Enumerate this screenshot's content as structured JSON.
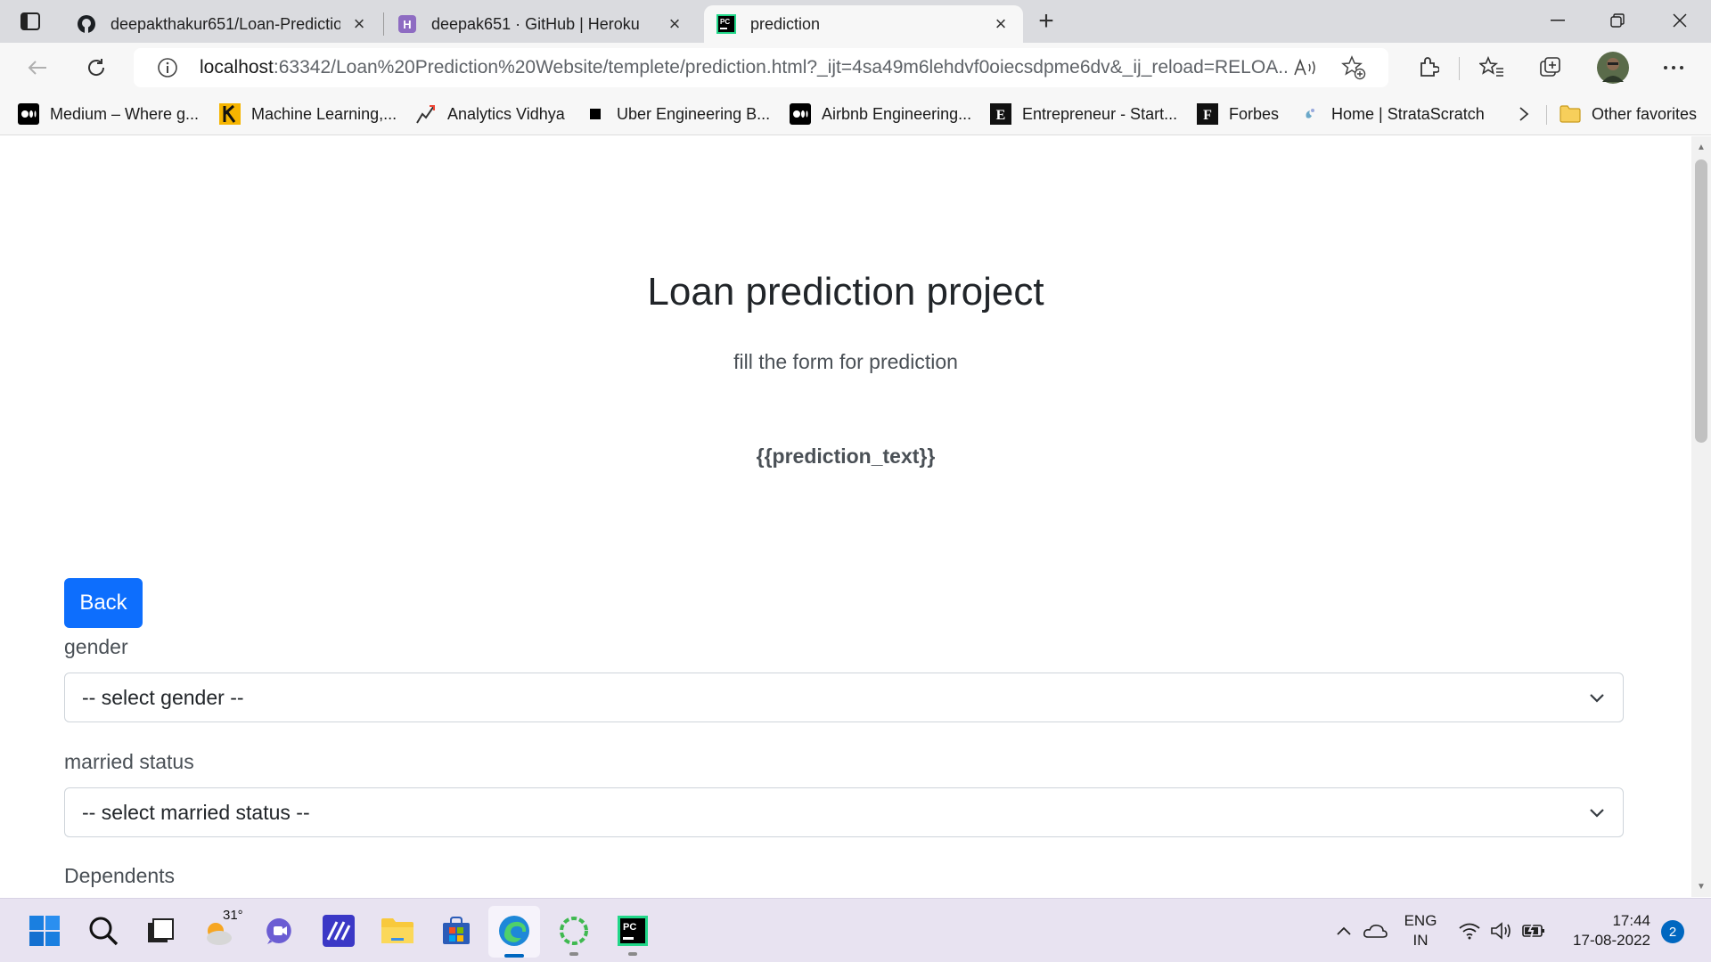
{
  "browser": {
    "tabs": [
      {
        "title": "deepakthakur651/Loan-Predictio",
        "icon": "github-icon"
      },
      {
        "title": "deepak651 · GitHub | Heroku",
        "icon": "heroku-icon"
      },
      {
        "title": "prediction",
        "icon": "pycharm-icon"
      }
    ],
    "active_tab": 2,
    "url_host": "localhost",
    "url_rest": ":63342/Loan%20Prediction%20Website/templete/prediction.html?_ijt=4sa49m6lehdvf0oiecsdpme6dv&_ij_reload=RELOA...",
    "read_aloud": "A’’",
    "favorites": [
      {
        "label": "Medium – Where g...",
        "icon": "medium-icon"
      },
      {
        "label": "Machine Learning,...",
        "icon": "kdnuggets-icon"
      },
      {
        "label": "Analytics Vidhya",
        "icon": "analytics-vidhya-icon"
      },
      {
        "label": "Uber Engineering B...",
        "icon": "uber-icon"
      },
      {
        "label": "Airbnb Engineering...",
        "icon": "medium-icon"
      },
      {
        "label": "Entrepreneur - Start...",
        "icon": "entrepreneur-icon"
      },
      {
        "label": "Forbes",
        "icon": "forbes-icon"
      },
      {
        "label": "Home | StrataScratch",
        "icon": "stratascratch-icon"
      }
    ],
    "other_favorites": "Other favorites",
    "accent_color": "#0d6efd"
  },
  "page": {
    "title": "Loan prediction project",
    "subtitle": "fill the form for prediction",
    "prediction_text": "{{prediction_text}}",
    "back_label": "Back",
    "fields": [
      {
        "label": "gender",
        "placeholder": "-- select gender --"
      },
      {
        "label": "married status",
        "placeholder": "-- select married status --"
      },
      {
        "label": "Dependents"
      }
    ]
  },
  "taskbar": {
    "weather_temp": "31°",
    "lang_line1": "ENG",
    "lang_line2": "IN",
    "time": "17:44",
    "date": "17-08-2022",
    "notification_count": "2"
  }
}
